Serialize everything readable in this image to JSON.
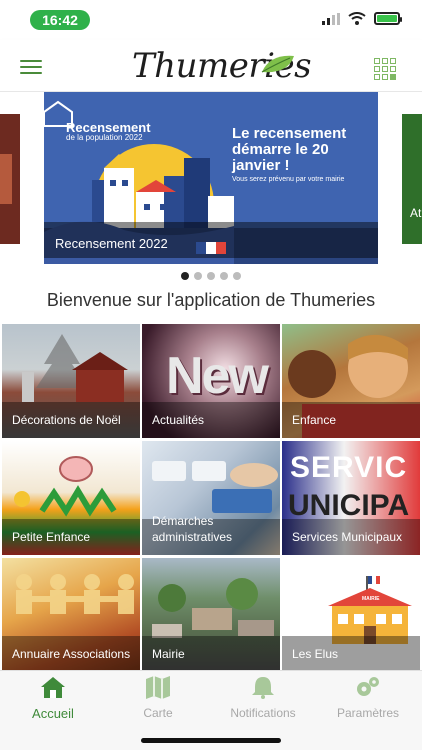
{
  "status_bar": {
    "time": "16:42",
    "icons": [
      "signal-icon",
      "wifi-icon",
      "battery-charging-icon"
    ],
    "time_pill_color": "#2fb14a"
  },
  "header": {
    "brand": "Thumeries",
    "menu_icon": "hamburger-menu-icon",
    "apps_icon": "grid-apps-icon",
    "accent": "#4a8b3a"
  },
  "carousel": {
    "slide": {
      "logo_title": "Recensement",
      "logo_sub": "de la population 2022",
      "heading": "Le recensement démarre le 20 janvier !",
      "small_text": "Vous serez prévenu par votre mairie",
      "caption": "Recensement 2022"
    },
    "peek_right_text": "At",
    "dots": {
      "count": 5,
      "active_index": 0
    }
  },
  "welcome": "Bienvenue sur l'application de Thumeries",
  "tiles": [
    {
      "label": "Décorations de Noël",
      "style": "noel"
    },
    {
      "label": "Actualités",
      "style": "actu",
      "art_text": "New"
    },
    {
      "label": "Enfance",
      "style": "enfance"
    },
    {
      "label": "Petite Enfance",
      "style": "petite"
    },
    {
      "label": "Démarches administratives",
      "style": "demarches"
    },
    {
      "label": "Services Municipaux",
      "style": "services",
      "art_text": "SERVIC",
      "art_text2": "UNICIPA"
    },
    {
      "label": "Annuaire Associations",
      "style": "asso"
    },
    {
      "label": "Mairie",
      "style": "mairie"
    },
    {
      "label": "Les Elus",
      "style": "elus",
      "art_text": "MAIRIE"
    }
  ],
  "tab_bar": {
    "tabs": [
      {
        "label": "Accueil",
        "icon": "home-icon",
        "active": true
      },
      {
        "label": "Carte",
        "icon": "map-icon",
        "active": false
      },
      {
        "label": "Notifications",
        "icon": "bell-icon",
        "active": false
      },
      {
        "label": "Paramètres",
        "icon": "gears-icon",
        "active": false
      }
    ],
    "active_color": "#3f8a3a",
    "inactive_color": "#a8a8a8"
  }
}
